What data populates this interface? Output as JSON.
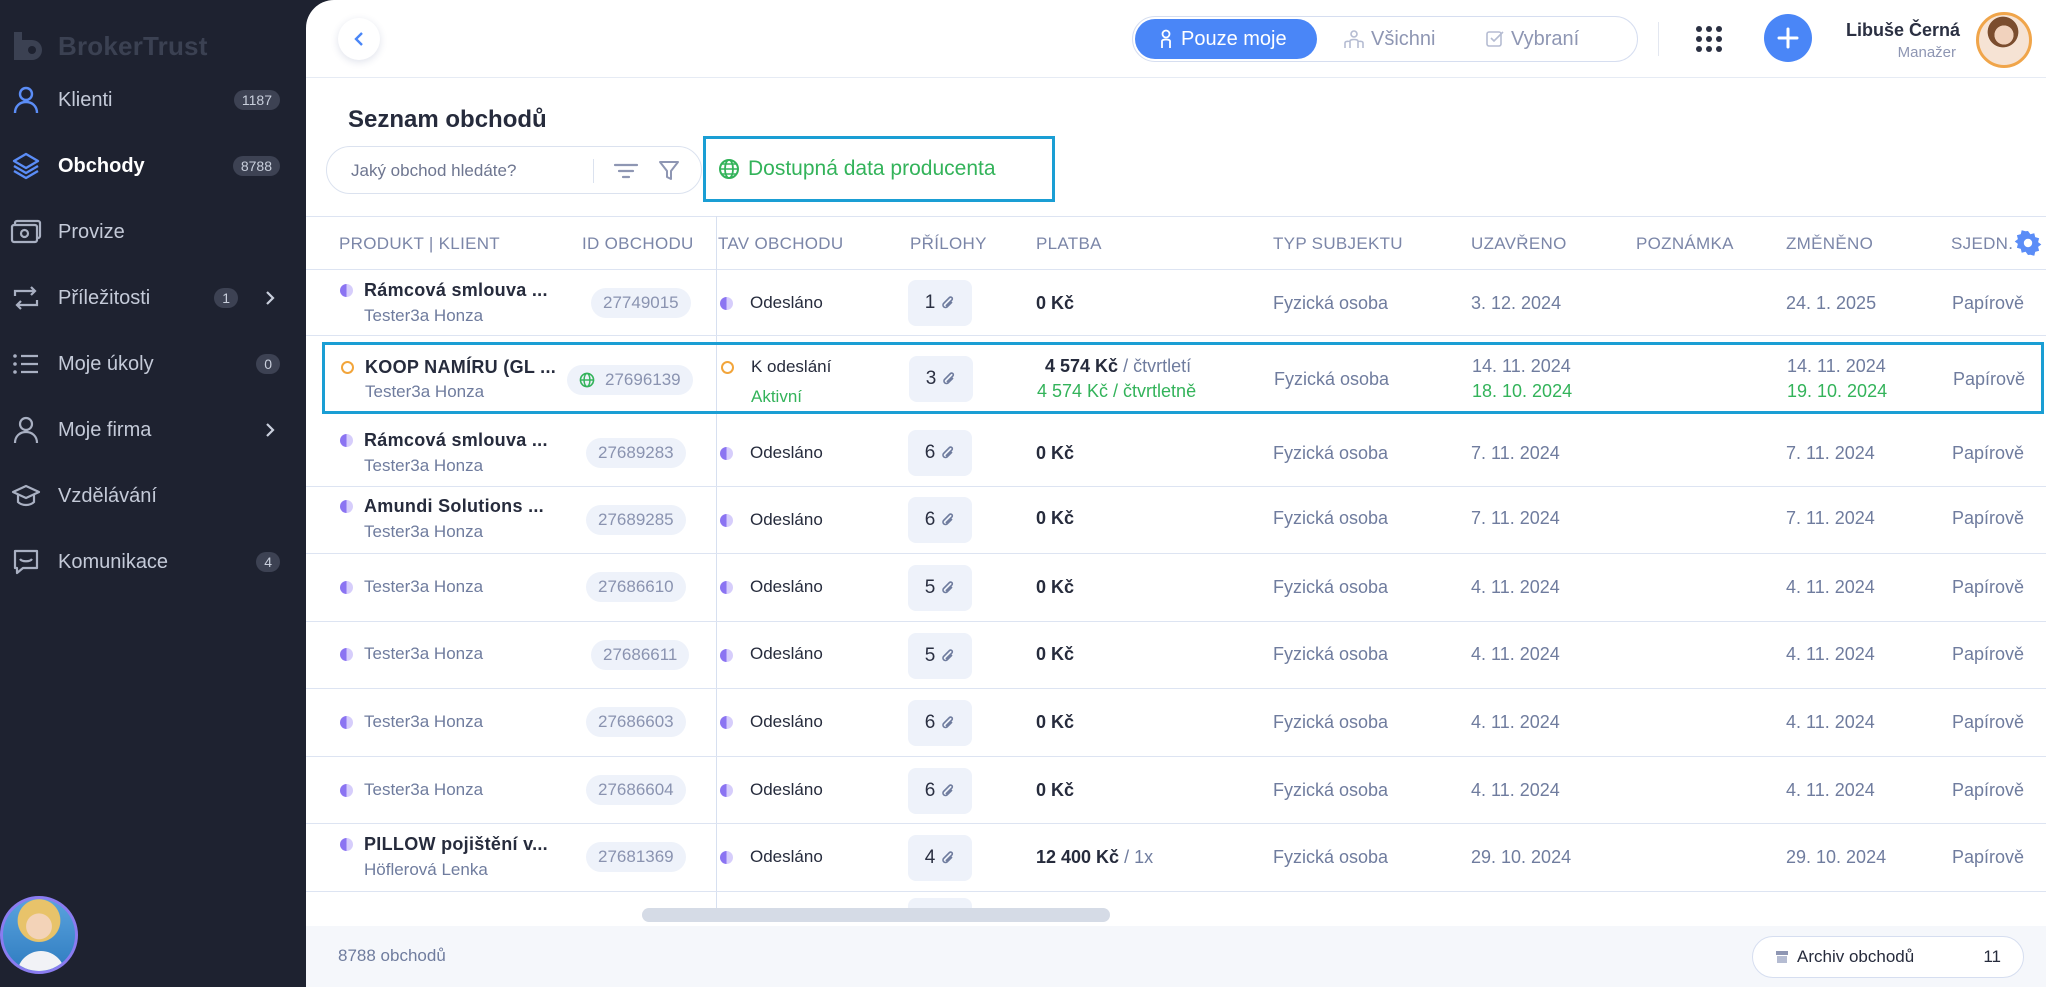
{
  "app": {
    "logo_text": "BrokerTrust"
  },
  "sidebar": {
    "items": [
      {
        "label": "Klienti",
        "badge": "1187"
      },
      {
        "label": "Obchody",
        "badge": "8788"
      },
      {
        "label": "Provize"
      },
      {
        "label": "Příležitosti",
        "badge": "1"
      },
      {
        "label": "Moje úkoly",
        "badge": "0"
      },
      {
        "label": "Moje firma"
      },
      {
        "label": "Vzdělávání"
      },
      {
        "label": "Komunikace",
        "badge": "4"
      }
    ]
  },
  "topbar": {
    "filters": [
      {
        "label": "Pouze moje"
      },
      {
        "label": "Všichni"
      },
      {
        "label": "Vybraní"
      }
    ],
    "user": {
      "name": "Libuše Černá",
      "role": "Manažer"
    }
  },
  "page": {
    "title": "Seznam obchodů",
    "search_placeholder": "Jaký obchod hledáte?",
    "producer_label": "Dostupná data producenta"
  },
  "table": {
    "columns": [
      "PRODUKT | KLIENT",
      "ID OBCHODU",
      "TAV OBCHODU",
      "PŘÍLOHY",
      "PLATBA",
      "TYP SUBJEKTU",
      "UZAVŘENO",
      "POZNÁMKA",
      "ZMĚNĚNO",
      "SJEDN."
    ],
    "rows": [
      {
        "product": "Rámcová smlouva ...",
        "client": "Tester3a Honza",
        "id": "27749015",
        "status": "Odesláno",
        "attachments": "1",
        "payment": "0 Kč",
        "subject": "Fyzická osoba",
        "closed": "3. 12. 2024",
        "changed": "24. 1. 2025",
        "agreed": "Papírově"
      },
      {
        "product": "KOOP NAMÍRU (GL ...",
        "client": "Tester3a Honza",
        "id": "27696139",
        "status": "K odeslání",
        "status_sub": "Aktivní",
        "attachments": "3",
        "payment": "4 574 Kč",
        "payment_freq": "/ čtvrtletí",
        "payment2": "4 574 Kč / čtvrtletně",
        "subject": "Fyzická osoba",
        "closed": "14. 11. 2024",
        "closed2": "18. 10. 2024",
        "changed": "14. 11. 2024",
        "changed2": "19. 10. 2024",
        "agreed": "Papírově"
      },
      {
        "product": "Rámcová smlouva ...",
        "client": "Tester3a Honza",
        "id": "27689283",
        "status": "Odesláno",
        "attachments": "6",
        "payment": "0 Kč",
        "subject": "Fyzická osoba",
        "closed": "7. 11. 2024",
        "changed": "7. 11. 2024",
        "agreed": "Papírově"
      },
      {
        "product": "Amundi Solutions ...",
        "client": "Tester3a Honza",
        "id": "27689285",
        "status": "Odesláno",
        "attachments": "6",
        "payment": "0 Kč",
        "subject": "Fyzická osoba",
        "closed": "7. 11. 2024",
        "changed": "7. 11. 2024",
        "agreed": "Papírově"
      },
      {
        "client": "Tester3a Honza",
        "id": "27686610",
        "status": "Odesláno",
        "attachments": "5",
        "payment": "0 Kč",
        "subject": "Fyzická osoba",
        "closed": "4. 11. 2024",
        "changed": "4. 11. 2024",
        "agreed": "Papírově"
      },
      {
        "client": "Tester3a Honza",
        "id": "27686611",
        "status": "Odesláno",
        "attachments": "5",
        "payment": "0 Kč",
        "subject": "Fyzická osoba",
        "closed": "4. 11. 2024",
        "changed": "4. 11. 2024",
        "agreed": "Papírově"
      },
      {
        "client": "Tester3a Honza",
        "id": "27686603",
        "status": "Odesláno",
        "attachments": "6",
        "payment": "0 Kč",
        "subject": "Fyzická osoba",
        "closed": "4. 11. 2024",
        "changed": "4. 11. 2024",
        "agreed": "Papírově"
      },
      {
        "client": "Tester3a Honza",
        "id": "27686604",
        "status": "Odesláno",
        "attachments": "6",
        "payment": "0 Kč",
        "subject": "Fyzická osoba",
        "closed": "4. 11. 2024",
        "changed": "4. 11. 2024",
        "agreed": "Papírově"
      },
      {
        "product": "PILLOW pojištění v...",
        "client": "Höflerová Lenka",
        "id": "27681369",
        "status": "Odesláno",
        "attachments": "4",
        "payment": "12 400 Kč",
        "payment_freq": "/ 1x",
        "subject": "Fyzická osoba",
        "closed": "29. 10. 2024",
        "changed": "29. 10. 2024",
        "agreed": "Papírově"
      }
    ]
  },
  "footer": {
    "count": "8788 obchodů",
    "archive_label": "Archiv obchodů",
    "archive_count": "11"
  },
  "colors": {
    "accent": "#4a86f7",
    "sidebar_bg": "#1e2230",
    "green": "#33b35a",
    "highlight": "#1a9ed4",
    "orange": "#f2a53b",
    "purple": "#8b74f2"
  }
}
